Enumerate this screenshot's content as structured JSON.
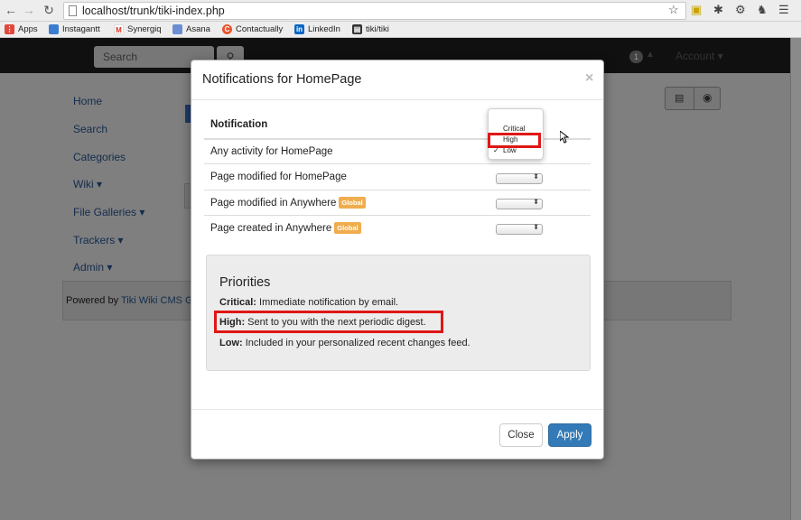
{
  "browser": {
    "url": "localhost/trunk/tiki-index.php",
    "bookmarks": [
      {
        "label": "Apps",
        "icon": "apps-grid-icon",
        "color": "#e0483b"
      },
      {
        "label": "Instagantt",
        "icon": "instagantt-icon",
        "color": "#3b7bd1"
      },
      {
        "label": "Synergiq",
        "icon": "gmail-icon",
        "color": "#d93025"
      },
      {
        "label": "Asana",
        "icon": "asana-icon",
        "color": "#6a8ed1"
      },
      {
        "label": "Contactually",
        "icon": "contactually-icon",
        "color": "#e8542f"
      },
      {
        "label": "LinkedIn",
        "icon": "linkedin-icon",
        "color": "#0a66c2"
      },
      {
        "label": "tiki/tiki",
        "icon": "terminal-icon",
        "color": "#333333"
      }
    ]
  },
  "site": {
    "search_placeholder": "Search",
    "notification_count": "1",
    "account_label": "Account ▾",
    "sidebar": [
      "Home",
      "Search",
      "Categories",
      "Wiki ▾",
      "File Galleries ▾",
      "Trackers ▾",
      "Admin ▾"
    ],
    "footer_prefix": "Powered by ",
    "footer_link": "Tiki Wiki CMS G"
  },
  "modal": {
    "title": "Notifications for HomePage",
    "close_glyph": "×",
    "table_header": "Notification",
    "rows": [
      {
        "label": "Any activity for HomePage",
        "badge": ""
      },
      {
        "label": "Page modified for HomePage",
        "badge": ""
      },
      {
        "label": "Page modified in Anywhere",
        "badge": "Global"
      },
      {
        "label": "Page created in Anywhere",
        "badge": "Global"
      }
    ],
    "dropdown_options": [
      {
        "label": "Critical",
        "checked": false
      },
      {
        "label": "High",
        "checked": false,
        "highlighted": true
      },
      {
        "label": "Low",
        "checked": true
      }
    ],
    "checkmark": "✓",
    "priorities": {
      "title": "Priorities",
      "items": [
        {
          "term": "Critical:",
          "text": " Immediate notification by email."
        },
        {
          "term": "High:",
          "text": " Sent to you with the next periodic digest."
        },
        {
          "term": "Low:",
          "text": " Included in your personalized recent changes feed."
        }
      ]
    },
    "close_button": "Close",
    "apply_button": "Apply"
  },
  "colors": {
    "primary_button": "#337ab7",
    "global_badge": "#f0ad4e",
    "highlight": "#e01616",
    "overlay": "#7f7f7f"
  }
}
